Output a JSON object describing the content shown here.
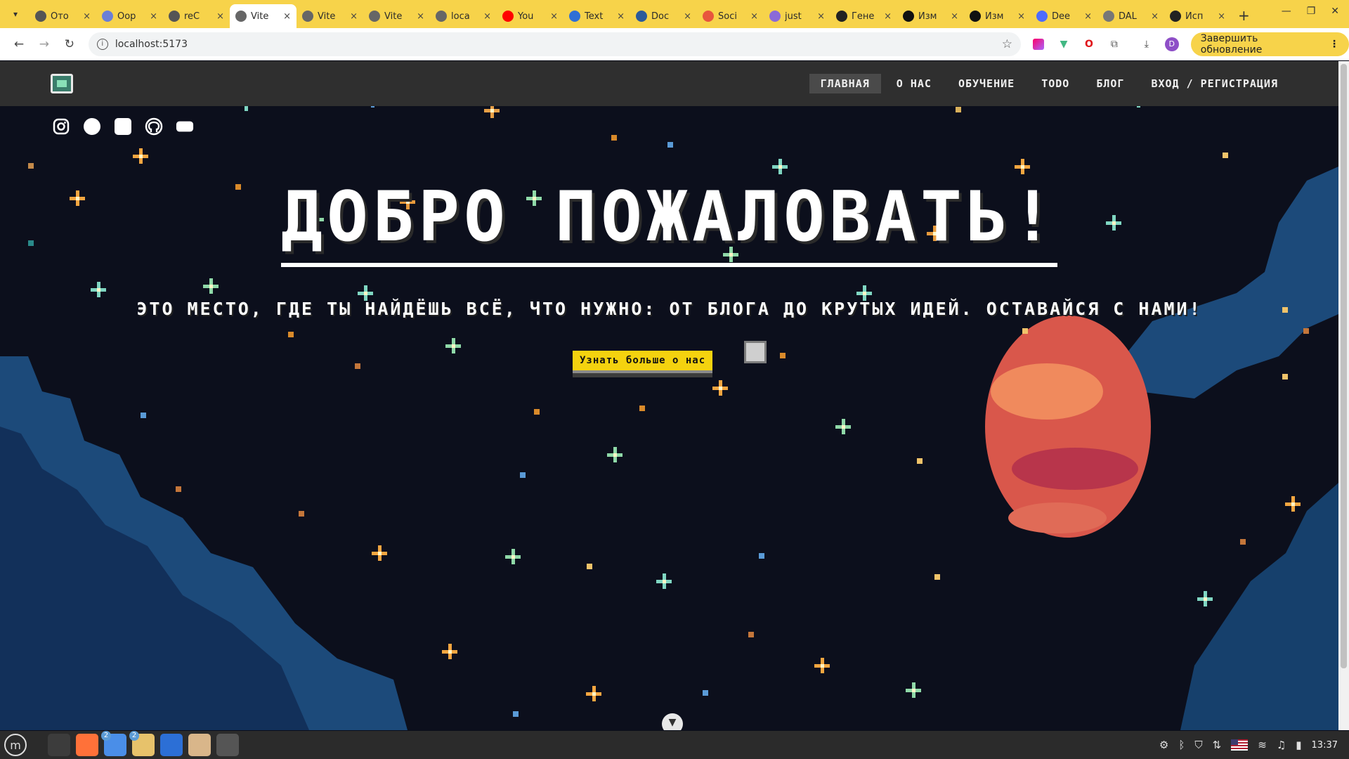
{
  "browser": {
    "tabs": [
      {
        "title": "Ото",
        "color": "#555555"
      },
      {
        "title": "Оор",
        "color": "#6b7fd6"
      },
      {
        "title": "reC",
        "color": "#555555"
      },
      {
        "title": "Vite",
        "color": "#666666",
        "active": true
      },
      {
        "title": "Vite",
        "color": "#666666"
      },
      {
        "title": "Vite",
        "color": "#666666"
      },
      {
        "title": "loca",
        "color": "#666666"
      },
      {
        "title": "You",
        "color": "#ff0000"
      },
      {
        "title": "Text",
        "color": "#2f6fd6"
      },
      {
        "title": "Doc",
        "color": "#2b5a9a"
      },
      {
        "title": "Soci",
        "color": "#e8553d"
      },
      {
        "title": "just",
        "color": "#8b6ad8"
      },
      {
        "title": "Гене",
        "color": "#222222"
      },
      {
        "title": "Изм",
        "color": "#111111"
      },
      {
        "title": "Изм",
        "color": "#111111"
      },
      {
        "title": "Dee",
        "color": "#4d6bfe"
      },
      {
        "title": "DAL",
        "color": "#777777"
      },
      {
        "title": "Исп",
        "color": "#222222"
      }
    ],
    "tab_close": "×",
    "new_tab": "+",
    "url": "localhost:5173",
    "update_button": "Завершить обновление",
    "profile_initial": "D"
  },
  "site": {
    "nav": [
      {
        "label": "ГЛАВНАЯ",
        "active": true
      },
      {
        "label": "О НАС"
      },
      {
        "label": "ОБУЧЕНИЕ"
      },
      {
        "label": "TODO"
      },
      {
        "label": "БЛОГ"
      },
      {
        "label": "ВХОД / РЕГИСТРАЦИЯ"
      }
    ],
    "social_icons": [
      "instagram-icon",
      "circle-icon",
      "square-icon",
      "github-icon",
      "youtube-icon"
    ],
    "hero": {
      "title": "ДОБРО ПОЖАЛОВАТЬ!",
      "subtitle": "ЭТО МЕСТО, ГДЕ ТЫ НАЙДЁШЬ ВСЁ, ЧТО НУЖНО: ОТ БЛОГА ДО КРУТЫХ ИДЕЙ. ОСТАВАЙСЯ С НАМИ!",
      "cta": "Узнать больше о нас"
    },
    "scroll_down": "▼"
  },
  "taskbar": {
    "apps": [
      {
        "name": "terminal",
        "color": "#3c3c3c"
      },
      {
        "name": "firefox",
        "color": "#ff7139"
      },
      {
        "name": "chrome",
        "color": "#4a8ee8",
        "badge": "2"
      },
      {
        "name": "files",
        "color": "#e7c26b",
        "badge": "2"
      },
      {
        "name": "intellij",
        "color": "#2c6fd6"
      },
      {
        "name": "archive",
        "color": "#d9b68a"
      },
      {
        "name": "inkscape",
        "color": "#555555"
      }
    ],
    "clock": "13:37"
  }
}
